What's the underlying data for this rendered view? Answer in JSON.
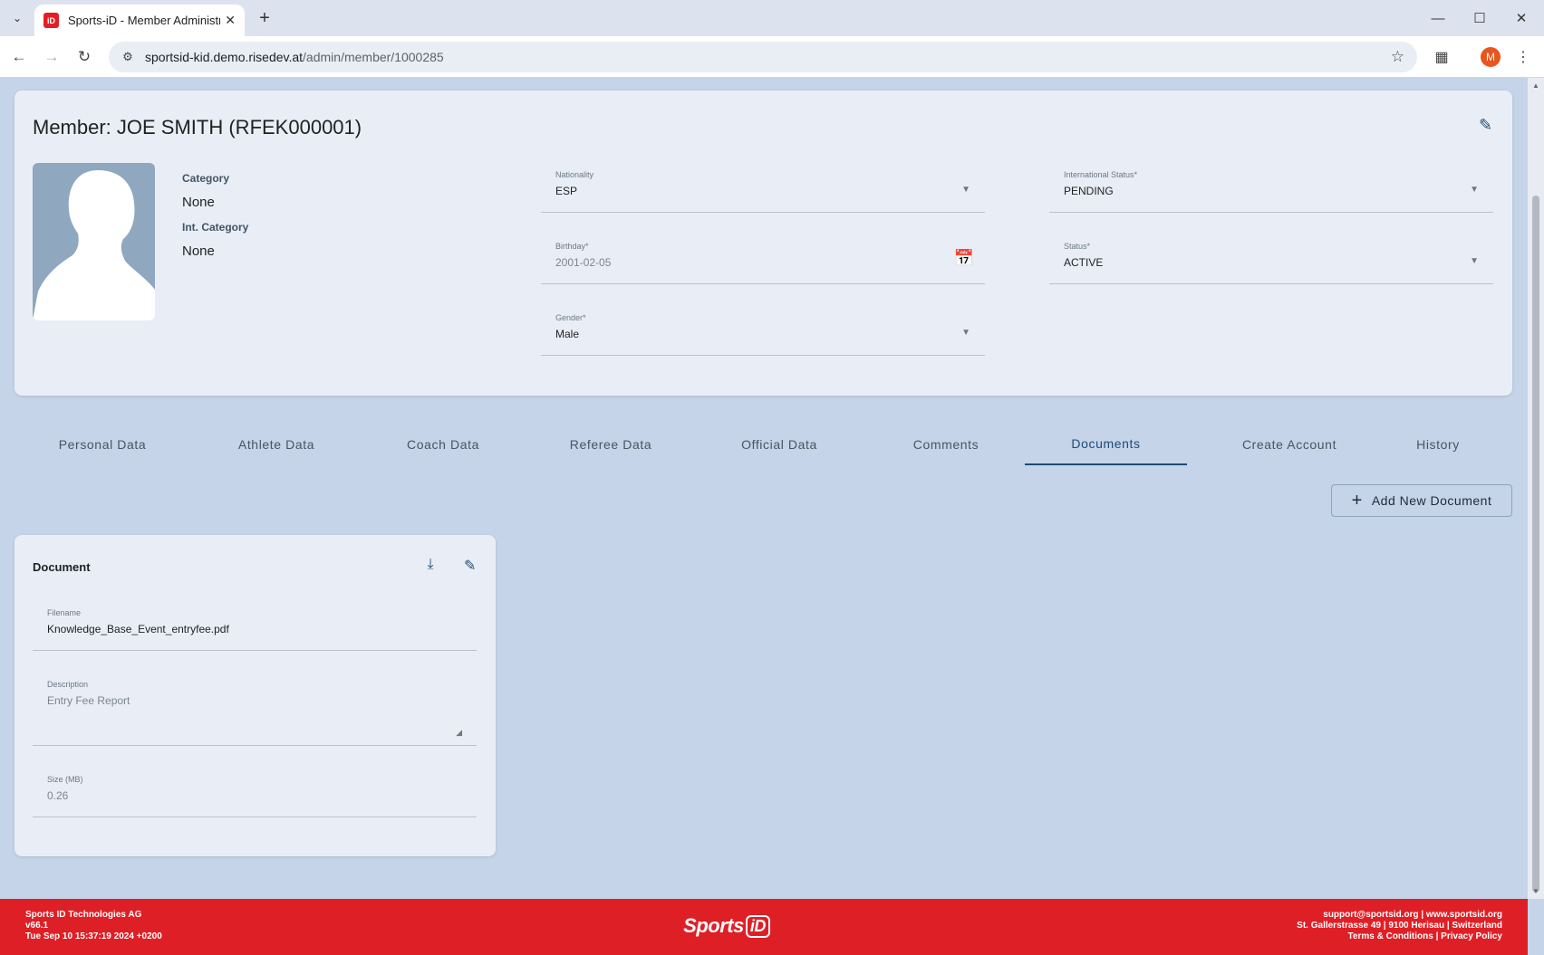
{
  "browser": {
    "tab_title": "Sports-iD - Member Administra",
    "favicon_text": "iD",
    "url_host": "sportsid-kid.demo.risedev.at",
    "url_path": "/admin/member/1000285",
    "profile_initial": "M"
  },
  "member": {
    "title": "Member: JOE SMITH (RFEK000001)",
    "category_label": "Category",
    "category_value": "None",
    "int_category_label": "Int. Category",
    "int_category_value": "None",
    "fields": {
      "nationality": {
        "label": "Nationality",
        "value": "ESP"
      },
      "birthday": {
        "label": "Birthday",
        "value": "2001-02-05"
      },
      "gender": {
        "label": "Gender",
        "value": "Male"
      },
      "intl_status": {
        "label": "International Status",
        "value": "PENDING"
      },
      "status": {
        "label": "Status",
        "value": "ACTIVE"
      }
    }
  },
  "tabs": [
    {
      "label": "Personal Data"
    },
    {
      "label": "Athlete Data"
    },
    {
      "label": "Coach Data"
    },
    {
      "label": "Referee Data"
    },
    {
      "label": "Official Data"
    },
    {
      "label": "Comments"
    },
    {
      "label": "Documents",
      "active": true
    },
    {
      "label": "Create Account"
    },
    {
      "label": "History"
    }
  ],
  "add_document_label": "Add New Document",
  "document": {
    "title": "Document",
    "filename_label": "Filename",
    "filename_value": "Knowledge_Base_Event_entryfee.pdf",
    "description_label": "Description",
    "description_value": "Entry Fee Report",
    "size_label": "Size (MB)",
    "size_value": "0.26"
  },
  "footer": {
    "company": "Sports ID Technologies AG",
    "version": "v66.1",
    "build_date": "Tue Sep 10 15:37:19 2024 +0200",
    "contact": "support@sportsid.org | www.sportsid.org",
    "address": "St. Gallerstrasse 49 | 9100 Herisau | Switzerland",
    "legal": "Terms & Conditions | Privacy Policy",
    "logo_text": "Sports",
    "logo_id": "iD"
  },
  "colors": {
    "accent": "#1e4a78",
    "footer": "#df1f26",
    "page_bg": "#c5d4e8",
    "card_bg": "#e9eef6"
  }
}
